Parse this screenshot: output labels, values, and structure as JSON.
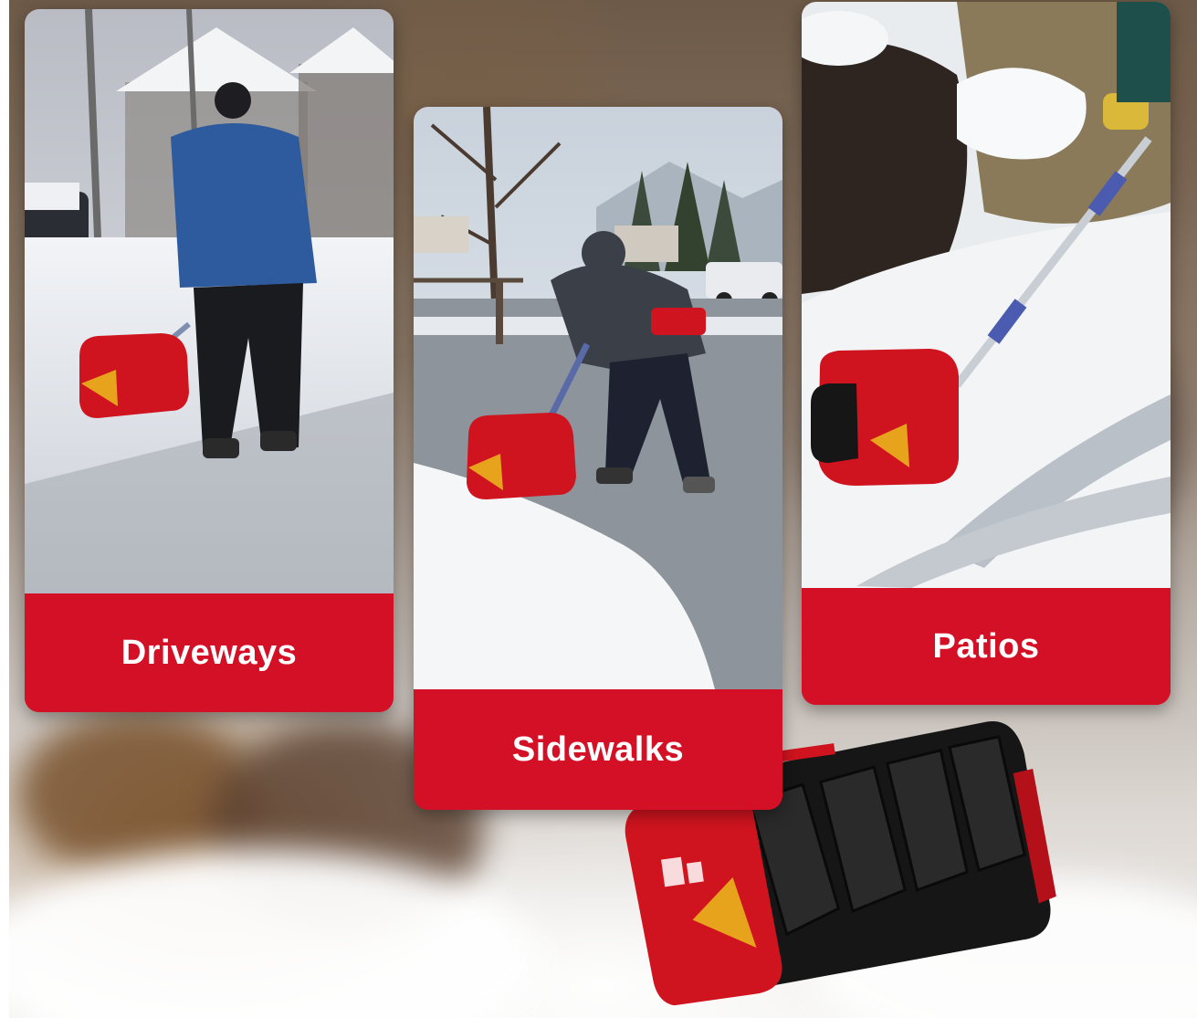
{
  "cards": [
    {
      "label": "Driveways"
    },
    {
      "label": "Sidewalks"
    },
    {
      "label": "Patios"
    }
  ],
  "colors": {
    "label_background": "#d31026",
    "label_text": "#ffffff",
    "product_red": "#d0141f",
    "product_black": "#161616",
    "snow": "#f4f6f8"
  }
}
